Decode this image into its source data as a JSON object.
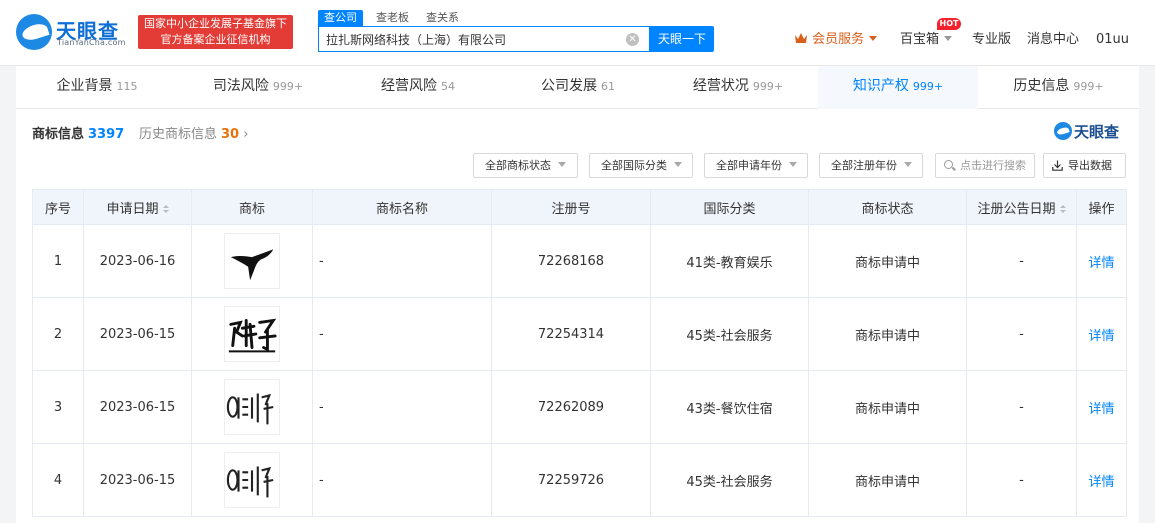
{
  "header": {
    "brand_name": "天眼查",
    "brand_domain": "TianYanCha.com",
    "gov_badge_line1": "国家中小企业发展子基金旗下",
    "gov_badge_line2": "官方备案企业征信机构",
    "search_tabs": [
      {
        "label": "查公司",
        "active": true
      },
      {
        "label": "查老板",
        "active": false
      },
      {
        "label": "查关系",
        "active": false
      }
    ],
    "search_value": "拉扎斯网络科技（上海）有限公司",
    "search_button": "天眼一下",
    "vip_label": "会员服务",
    "baibao_label": "百宝箱",
    "hot_badge": "HOT",
    "pro_label": "专业版",
    "msg_label": "消息中心",
    "user_label": "01uu"
  },
  "tabs": [
    {
      "label": "企业背景",
      "count": "115",
      "active": false
    },
    {
      "label": "司法风险",
      "count": "999+",
      "active": false
    },
    {
      "label": "经营风险",
      "count": "54",
      "active": false
    },
    {
      "label": "公司发展",
      "count": "61",
      "active": false
    },
    {
      "label": "经营状况",
      "count": "999+",
      "active": false
    },
    {
      "label": "知识产权",
      "count": "999+",
      "active": true
    },
    {
      "label": "历史信息",
      "count": "999+",
      "active": false
    }
  ],
  "section": {
    "title": "商标信息",
    "count": "3397",
    "history_label": "历史商标信息",
    "history_count": "30",
    "watermark": "天眼查"
  },
  "filters": {
    "status": "全部商标状态",
    "intl_class": "全部国际分类",
    "apply_year": "全部申请年份",
    "reg_year": "全部注册年份",
    "search_placeholder": "点击进行搜索",
    "export": "导出数据"
  },
  "table": {
    "headers": [
      "序号",
      "申请日期",
      "商标",
      "商标名称",
      "注册号",
      "国际分类",
      "商标状态",
      "注册公告日期",
      "操作"
    ],
    "rows": [
      {
        "index": "1",
        "date": "2023-06-16",
        "logo": "bird-logo",
        "name": "-",
        "reg_no": "72268168",
        "class": "41类-教育娱乐",
        "status": "商标申请中",
        "announce_date": "-",
        "action": "详情"
      },
      {
        "index": "2",
        "date": "2023-06-15",
        "logo": "fanbaozi-logo",
        "name": "-",
        "reg_no": "72254314",
        "class": "45类-社会服务",
        "status": "商标申请中",
        "announce_date": "-",
        "action": "详情"
      },
      {
        "index": "3",
        "date": "2023-06-15",
        "logo": "elemez-fanbaozi-logo",
        "name": "-",
        "reg_no": "72262089",
        "class": "43类-餐饮住宿",
        "status": "商标申请中",
        "announce_date": "-",
        "action": "详情"
      },
      {
        "index": "4",
        "date": "2023-06-15",
        "logo": "elemez-fanbaozi-logo",
        "name": "-",
        "reg_no": "72259726",
        "class": "45类-社会服务",
        "status": "商标申请中",
        "announce_date": "-",
        "action": "详情"
      }
    ]
  },
  "colors": {
    "accent": "#0084ff",
    "badge_red": "#e33c36",
    "vip_orange": "#d95f1c",
    "history_count": "#e8710a"
  }
}
